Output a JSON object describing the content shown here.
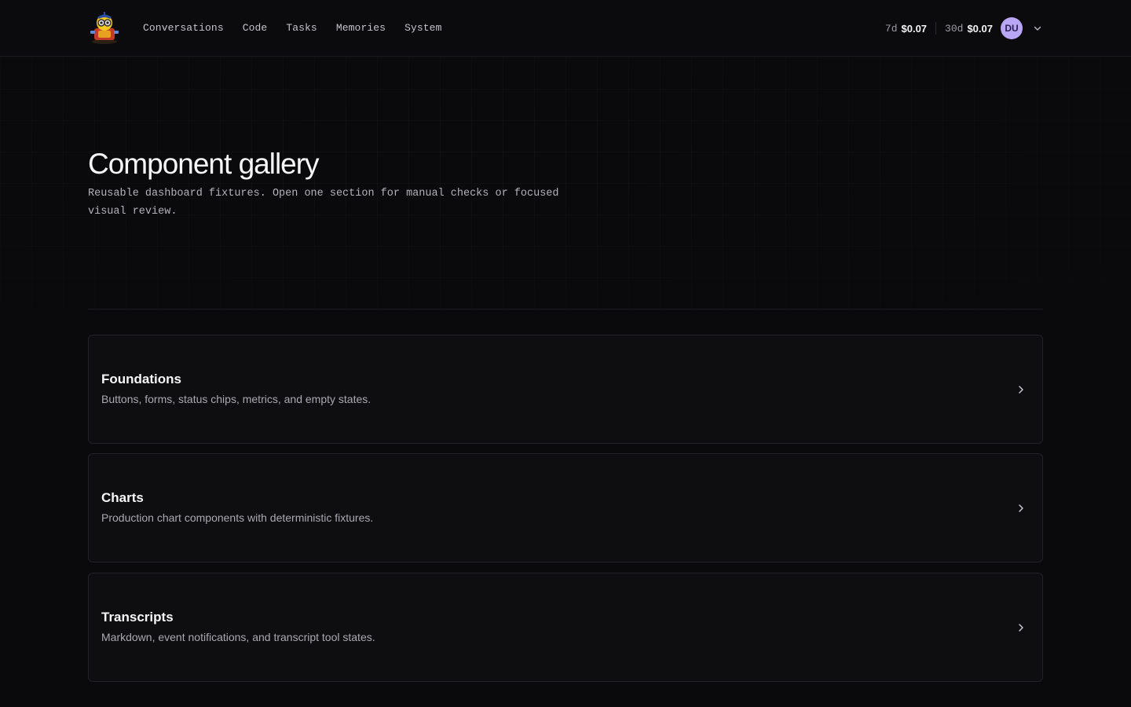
{
  "nav": {
    "items": [
      {
        "label": "Conversations"
      },
      {
        "label": "Code"
      },
      {
        "label": "Tasks"
      },
      {
        "label": "Memories"
      },
      {
        "label": "System"
      }
    ]
  },
  "spend": {
    "week_period": "7d",
    "week_amount": "$0.07",
    "month_period": "30d",
    "month_amount": "$0.07"
  },
  "user": {
    "initials": "DU"
  },
  "icons": {
    "logo": "robot-mascot-logo",
    "menu": "chevron-down-icon",
    "card_arrow": "chevron-right-icon"
  },
  "page": {
    "title": "Component gallery",
    "subtitle": "Reusable dashboard fixtures. Open one section for manual checks or focused visual review."
  },
  "sections": [
    {
      "title": "Foundations",
      "description": "Buttons, forms, status chips, metrics, and empty states."
    },
    {
      "title": "Charts",
      "description": "Production chart components with deterministic fixtures."
    },
    {
      "title": "Transcripts",
      "description": "Markdown, event notifications, and transcript tool states."
    }
  ],
  "colors": {
    "background": "#0a0a0c",
    "avatar": "#b9a6f5",
    "card_border": "#222227"
  }
}
